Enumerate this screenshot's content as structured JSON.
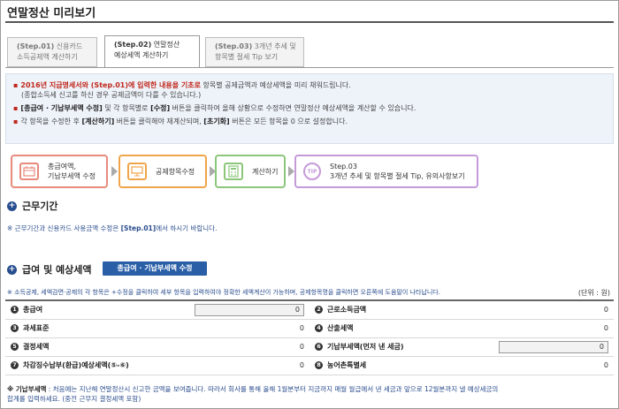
{
  "page": {
    "title": "연말정산 미리보기"
  },
  "tabs": [
    {
      "step": "(Step.01)",
      "line1": " 신용카드",
      "line2": "소득공제액 계산하기",
      "active": false
    },
    {
      "step": "(Step.02)",
      "line1": " 연말정산",
      "line2": "예상세액 계산하기",
      "active": true
    },
    {
      "step": "(Step.03)",
      "line1": " 3개년 추세 및",
      "line2": "항목별 절세 Tip 보기",
      "active": false
    }
  ],
  "notice": {
    "line1_red": "2016년 지급명세서와 (Step.01)에 입력한 내용을 기초로",
    "line1_rest": " 항목별 공제금액과 예상세액을 미리 채워드립니다.",
    "line2": "(종합소득세 신고를 하신 경우 공제금액이 다를 수 있습니다.)",
    "line3_b1": "[총급여 · 기납부세액 수정]",
    "line3_mid": " 및 각 항목별로 ",
    "line3_b2": "[수정]",
    "line3_rest": " 버튼을 클릭하여 올해 상황으로 수정하면 연말정산 예상세액을 계산할 수 있습니다.",
    "line4_a": "각 항목을 수정한 후 ",
    "line4_b1": "[계산하기]",
    "line4_mid": " 버튼을 클릭해야 재계산되며, ",
    "line4_b2": "[초기화]",
    "line4_rest": " 버튼은 모든 항목을 0 으로 설정합니다."
  },
  "flow": [
    {
      "line1": "총급여액,",
      "line2": "기납부세액 수정",
      "color": "#e88a7c",
      "icon": "calendar-icon"
    },
    {
      "line1": "공제항목수정",
      "line2": "",
      "color": "#f0a54a",
      "icon": "monitor-icon"
    },
    {
      "line1": "계산하기",
      "line2": "",
      "color": "#8cc67a",
      "icon": "calculator-icon"
    },
    {
      "line1": "Step.03",
      "line2": "3개년 추세 및 항목별 절세 Tip, 유의사항보기",
      "color": "#c59ad9",
      "icon": "tip-icon"
    }
  ],
  "work_period": {
    "heading": "근무기간",
    "note_a": "※ 근무기간과 신용카드 사용금액 수정은 ",
    "note_b": "[Step.01]",
    "note_c": "에서 하시기 바랍니다."
  },
  "salary": {
    "heading": "급여 및 예상세액",
    "edit_button": "총급여 · 기납부세액 수정",
    "note": "※ 소득공제, 세액감면·공제의 각 항목은 +수정을 클릭하여 세부 항목을 입력하여야 정확한 세액계산이 가능하며, 공제항목명을 클릭하면 오른쪽에 도움말이 나타납니다.",
    "unit": "(단위 : 원)",
    "rows": [
      {
        "n1": "1",
        "l1": "총급여",
        "v1": "0",
        "box1": true,
        "n2": "2",
        "l2": "근로소득금액",
        "v2": "0",
        "box2": false
      },
      {
        "n1": "3",
        "l1": "과세표준",
        "v1": "0",
        "box1": false,
        "n2": "4",
        "l2": "산출세액",
        "v2": "0",
        "box2": false
      },
      {
        "n1": "5",
        "l1": "결정세액",
        "v1": "0",
        "box1": false,
        "n2": "6",
        "l2": "기납부세액(먼저 낸 세금)",
        "v2": "0",
        "box2": true
      },
      {
        "n1": "7",
        "l1": "차감징수납부(환급)예상세액(⑤-⑥)",
        "v1": "0",
        "box1": false,
        "n2": "8",
        "l2": "농어촌특별세",
        "v2": "0",
        "box2": false
      }
    ]
  },
  "footer": {
    "label": "※ 기납부세액",
    "text": " : 처음에는 지난해 연말정산시 신고한 금액을 보여줍니다. 따라서 회사를 통해 올해 1월분부터 지금까지 매월 월급에서 낸 세금과 앞으로 12월분까지 낼 예상세금의",
    "text2": "합계를 입력하세요. (중전 근무지 결정세액 포함)"
  },
  "colors": {
    "accent_red": "#c0271b",
    "accent_blue": "#2a5fa8",
    "note_blue": "#2a4d8e"
  }
}
